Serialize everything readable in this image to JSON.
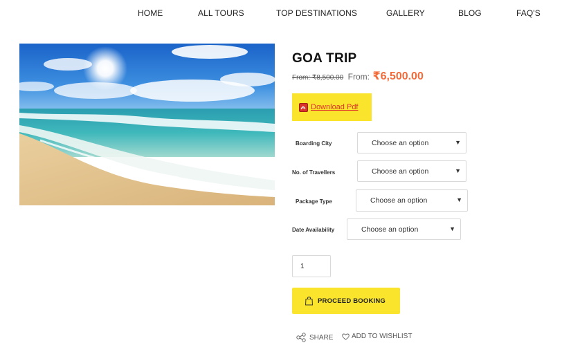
{
  "nav": {
    "items": [
      "HOME",
      "ALL TOURS",
      "TOP DESTINATIONS",
      "GALLERY",
      "BLOG",
      "FAQ'S"
    ]
  },
  "product": {
    "title": "GOA TRIP",
    "old_price": "From: ₹8,500.00",
    "from_label": "From:",
    "price": "₹6,500.00",
    "pdf_label": "Download Pdf"
  },
  "options": [
    {
      "label": "Boarding City",
      "value": "Choose an option"
    },
    {
      "label": "No. of Travellers",
      "value": "Choose an option"
    },
    {
      "label": "Package Type",
      "value": "Choose an option"
    },
    {
      "label": "Date Availability",
      "value": "Choose an option"
    }
  ],
  "quantity": "1",
  "actions": {
    "book_label": "PROCEED BOOKING",
    "share_label": "SHARE",
    "wishlist_label": "ADD TO WISHLIST"
  },
  "icons": {
    "pdf": "pdf-icon",
    "bag": "shopping-bag-icon",
    "share": "share-icon",
    "heart": "heart-icon",
    "caret": "chevron-down-icon"
  },
  "colors": {
    "accent_yellow": "#fbe52c",
    "price_orange": "#f26b3a",
    "link_red": "#e0322b"
  }
}
